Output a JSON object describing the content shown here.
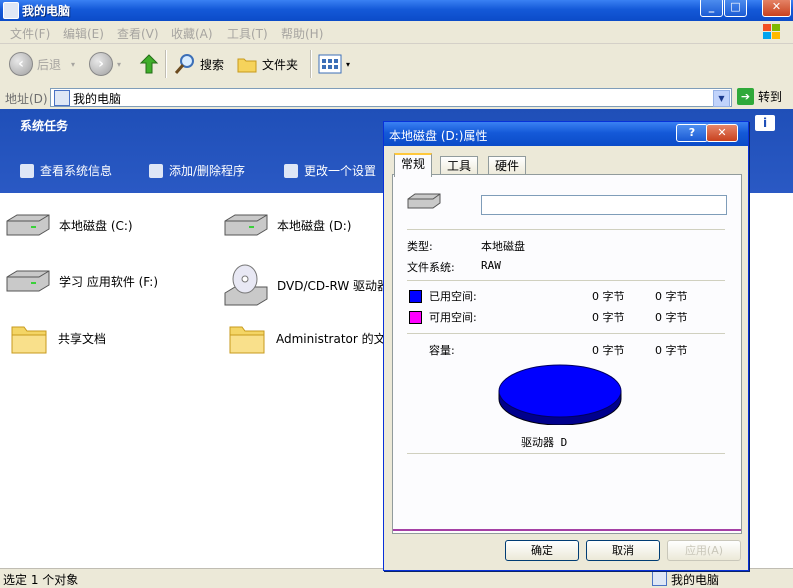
{
  "window": {
    "title": "我的电脑"
  },
  "menu": [
    "文件(F)",
    "编辑(E)",
    "查看(V)",
    "收藏(A)",
    "工具(T)",
    "帮助(H)"
  ],
  "toolbar": {
    "back": "后退",
    "search": "搜索",
    "folders": "文件夹"
  },
  "address": {
    "label": "地址(D)",
    "value": "我的电脑",
    "go": "转到"
  },
  "task_pane": {
    "title": "系统任务",
    "items": [
      "查看系统信息",
      "添加/删除程序",
      "更改一个设置"
    ]
  },
  "files": [
    {
      "name": "本地磁盘 (C:)",
      "type": "drive"
    },
    {
      "name": "本地磁盘 (D:)",
      "type": "drive"
    },
    {
      "name": "学习 应用软件 (F:)",
      "type": "drive"
    },
    {
      "name": "DVD/CD-RW 驱动器 (",
      "type": "cdrom"
    },
    {
      "name": "共享文档",
      "type": "folder"
    },
    {
      "name": "Administrator 的文档",
      "type": "folder"
    }
  ],
  "status": {
    "left": "选定 1 个对象",
    "right": "我的电脑"
  },
  "dialog": {
    "title": "本地磁盘 (D:)属性",
    "tabs": [
      "常规",
      "工具",
      "硬件"
    ],
    "type_label": "类型:",
    "type_value": "本地磁盘",
    "fs_label": "文件系统:",
    "fs_value": "RAW",
    "used_label": "已用空间:",
    "used_bytes": "0 字节",
    "used_size": "0 字节",
    "free_label": "可用空间:",
    "free_bytes": "0 字节",
    "free_size": "0 字节",
    "capacity_label": "容量:",
    "capacity_bytes": "0 字节",
    "capacity_size": "0 字节",
    "drive_label": "驱动器 D",
    "buttons": {
      "ok": "确定",
      "cancel": "取消",
      "apply": "应用(A)"
    },
    "colors": {
      "used": "#0000ff",
      "free": "#ff00ff"
    }
  }
}
